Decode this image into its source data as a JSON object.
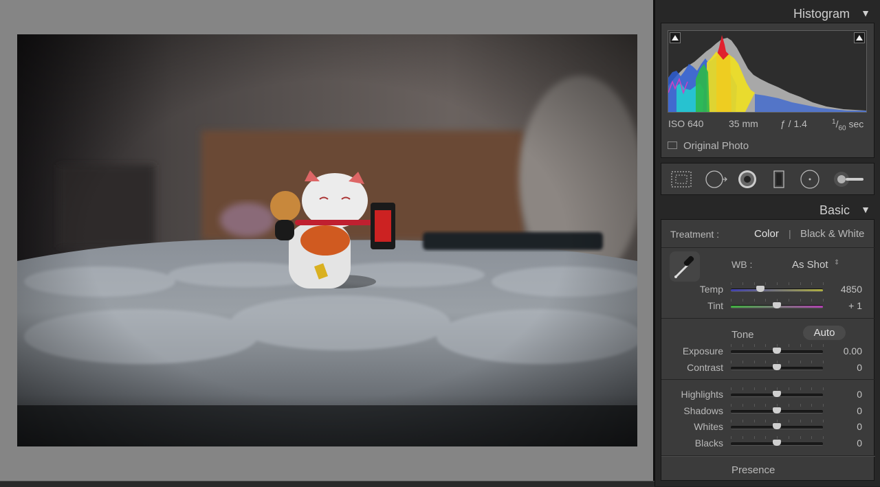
{
  "colors": {
    "canvas_bg": "#858585",
    "panel_bg": "#272727",
    "section_bg": "#3b3b3b",
    "hist_blue": "#2f5fd6",
    "hist_red": "#e0202e",
    "hist_yellow": "#f0e020",
    "hist_cyan": "#27c2d0",
    "hist_green": "#2fb84a",
    "hist_magenta": "#d040c0",
    "temp_left": "#4040b0",
    "temp_right": "#b0b040",
    "tint_left": "#40b040",
    "tint_right": "#b040b0"
  },
  "histogram": {
    "title": "Histogram",
    "exif": {
      "iso": "ISO 640",
      "focal": "35 mm",
      "aperture": "ƒ / 1.4",
      "shutter_num": "1",
      "shutter_den": "60",
      "shutter_unit": "sec"
    },
    "original_photo_label": "Original Photo",
    "original_photo_checked": false
  },
  "tools": [
    {
      "name": "crop-overlay-icon"
    },
    {
      "name": "spot-removal-icon"
    },
    {
      "name": "red-eye-icon"
    },
    {
      "name": "graduated-filter-icon"
    },
    {
      "name": "radial-filter-icon"
    },
    {
      "name": "adjustment-brush-icon"
    }
  ],
  "basic": {
    "title": "Basic",
    "treatment_label": "Treatment :",
    "treatment_color": "Color",
    "treatment_divider": "|",
    "treatment_bw": "Black & White",
    "wb_label": "WB :",
    "wb_value": "As Shot",
    "temp": {
      "label": "Temp",
      "value": "4850",
      "pos": 0.32
    },
    "tint": {
      "label": "Tint",
      "value": "+ 1",
      "pos": 0.5
    },
    "tone_label": "Tone",
    "auto_label": "Auto",
    "exposure": {
      "label": "Exposure",
      "value": "0.00",
      "pos": 0.5
    },
    "contrast": {
      "label": "Contrast",
      "value": "0",
      "pos": 0.5
    },
    "highlights": {
      "label": "Highlights",
      "value": "0",
      "pos": 0.5
    },
    "shadows": {
      "label": "Shadows",
      "value": "0",
      "pos": 0.5
    },
    "whites": {
      "label": "Whites",
      "value": "0",
      "pos": 0.5
    },
    "blacks": {
      "label": "Blacks",
      "value": "0",
      "pos": 0.5
    },
    "presence_label": "Presence"
  }
}
